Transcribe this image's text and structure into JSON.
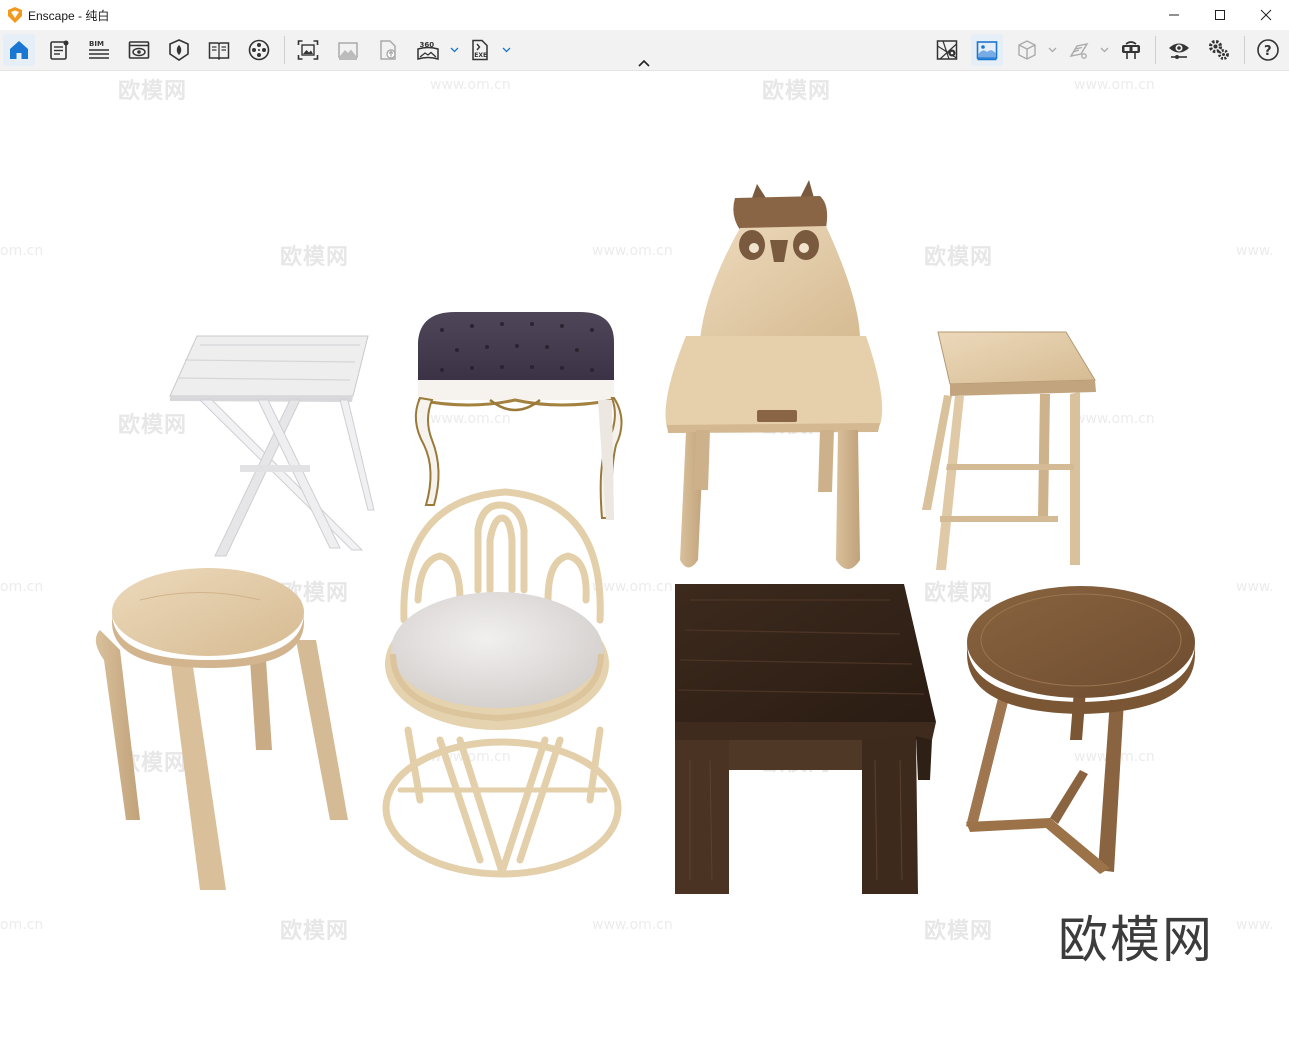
{
  "window": {
    "title": "Enscape - 纯白"
  },
  "toolbar": {
    "left_buttons": [
      {
        "icon": "home-icon"
      },
      {
        "icon": "notes-icon"
      },
      {
        "icon": "bim-icon",
        "label": "BIM"
      },
      {
        "icon": "views-icon"
      },
      {
        "icon": "asset-library-icon"
      },
      {
        "icon": "material-book-icon"
      },
      {
        "icon": "video-reel-icon"
      },
      {
        "icon": "screenshot-icon"
      },
      {
        "icon": "batch-render-icon"
      },
      {
        "icon": "upload-icon"
      },
      {
        "icon": "panorama-360-icon",
        "label": "360"
      },
      {
        "icon": "export-exe-icon",
        "label": "EXE"
      }
    ],
    "right_buttons": [
      {
        "icon": "map-pin-icon"
      },
      {
        "icon": "atmosphere-icon"
      },
      {
        "icon": "cube-icon"
      },
      {
        "icon": "layers-icon"
      },
      {
        "icon": "vr-headset-icon"
      },
      {
        "icon": "visual-settings-icon"
      },
      {
        "icon": "settings-icon"
      },
      {
        "icon": "help-icon",
        "label": "?"
      }
    ]
  },
  "viewport": {
    "watermark_cn": "欧模网",
    "watermark_url": "www.om.cn",
    "watermark_url_partial_left": "om.cn",
    "watermark_url_partial_right": "www.",
    "brand_logo": "欧模网"
  },
  "colors": {
    "accent": "#1976d2",
    "logo_orange": "#f39a1e",
    "toolbar_bg": "#f2f2f2"
  }
}
